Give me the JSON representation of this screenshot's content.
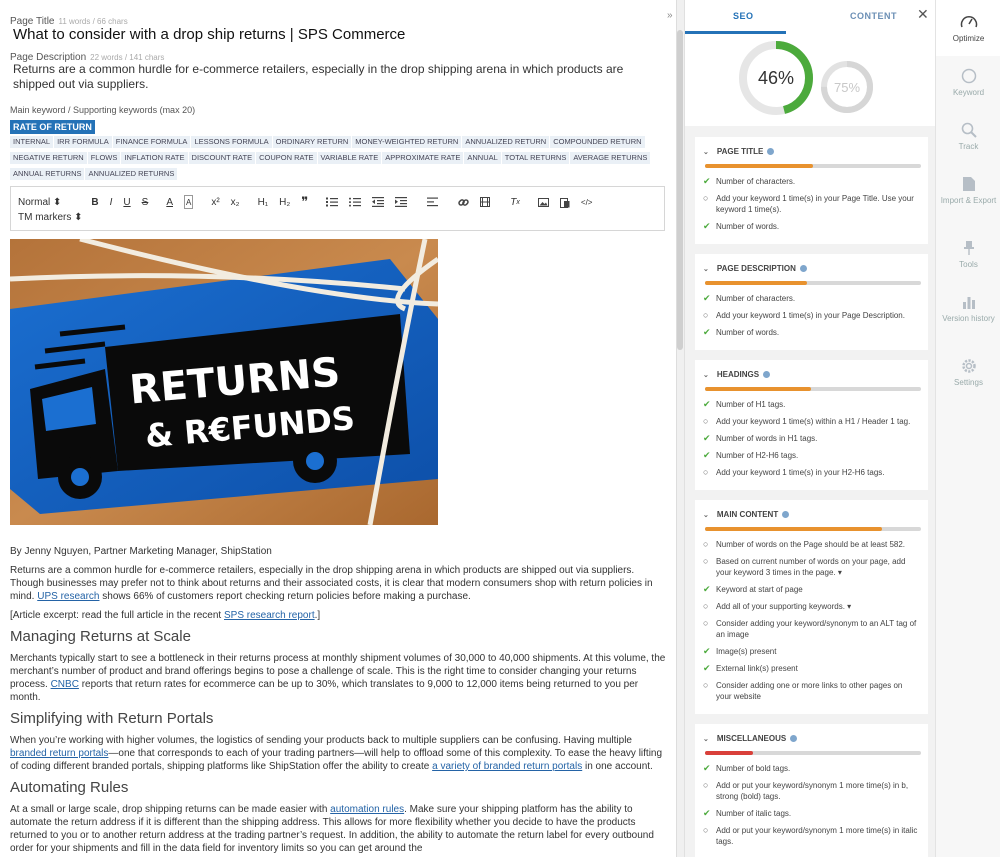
{
  "editor": {
    "page_title_label": "Page Title",
    "page_title_count": "11 words / 66 chars",
    "page_title": "What to consider with a drop ship returns | SPS Commerce",
    "page_desc_label": "Page Description",
    "page_desc_count": "22 words / 141 chars",
    "page_desc": "Returns are a common hurdle for e-commerce retailers, especially in the drop shipping arena in which products are shipped out via suppliers.",
    "kw_label": "Main keyword / Supporting keywords (max 20)",
    "main_keyword": "RATE OF RETURN",
    "tags": [
      "INTERNAL",
      "IRR FORMULA",
      "FINANCE FORMULA",
      "LESSONS FORMULA",
      "ORDINARY RETURN",
      "MONEY-WEIGHTED RETURN",
      "ANNUALIZED RETURN",
      "COMPOUNDED RETURN",
      "NEGATIVE RETURN",
      "FLOWS",
      "INFLATION RATE",
      "DISCOUNT RATE",
      "COUPON RATE",
      "VARIABLE RATE",
      "APPROXIMATE RATE",
      "ANNUAL",
      "TOTAL RETURNS",
      "AVERAGE RETURNS",
      "ANNUAL RETURNS",
      "ANNUALIZED RETURNS"
    ],
    "toolbar": {
      "format_select": "Normal ⬍",
      "bold": "B",
      "italic": "I",
      "underline": "U",
      "strike": "S",
      "color": "A",
      "bg": "A",
      "sup": "x²",
      "sub": "x₂",
      "h1": "H₁",
      "h2": "H₂",
      "quote": "❞",
      "tm_markers": "TM markers ⬍"
    },
    "hero_text_1": "RETURNS",
    "hero_text_2": "& R€FUNDS"
  },
  "article": {
    "author": "By Jenny Nguyen, Partner Marketing Manager, ShipStation",
    "p1_a": "Returns are a common hurdle for e-commerce retailers, especially in the drop shipping arena in which products are shipped out via suppliers. Though businesses may prefer not to think about returns and their associated costs, it is clear that modern consumers shop with return policies in mind. ",
    "p1_link": "UPS research",
    "p1_b": " shows 66% of customers report checking return policies before making a purchase.",
    "p2_a": "[Article excerpt: read the full article in the recent ",
    "p2_link": "SPS research report",
    "p2_b": ".]",
    "h_managing": "Managing Returns at Scale",
    "p3_a": "Merchants typically start to see a bottleneck in their returns process at monthly shipment volumes of 30,000 to 40,000 shipments. At this volume, the merchant’s number of product and brand offerings begins to pose a challenge of scale. This is the right time to consider changing your returns process. ",
    "p3_link": "CNBC",
    "p3_b": " reports that return rates for ecommerce can be up to 30%, which translates to 9,000 to 12,000 items being returned to you per month.",
    "h_simplifying": "Simplifying with Return Portals",
    "p4_a": "When you’re working with higher volumes, the logistics of sending your products back to multiple suppliers can be confusing. Having multiple ",
    "p4_link1": "branded return portals",
    "p4_b": "—one that corresponds to each of your trading partners—will help to offload some of this complexity. To ease the heavy lifting of coding different branded portals, shipping platforms like ShipStation offer the ability to create ",
    "p4_link2": "a variety of branded return portals",
    "p4_c": " in one account.",
    "h_automating": "Automating Rules",
    "p5_a": "At a small or large scale, drop shipping returns can be made easier with ",
    "p5_link": "automation rules",
    "p5_b": ". Make sure your shipping platform has the ability to automate the return address if it is different than the shipping address. This allows for more flexibility whether you decide to have the products returned to you or to another return address at the trading partner’s request. In addition, the ability to automate the return label for every outbound order for your shipments and fill in the data field for inventory limits so you can get around the"
  },
  "panel": {
    "tab_seo": "SEO",
    "tab_content": "CONTENT",
    "close": "✕",
    "score_main": "46%",
    "score_main_value": 46,
    "score_secondary": "75%",
    "score_secondary_value": 75,
    "colors": {
      "accent": "#2472b7",
      "green": "#4caa3c",
      "orange": "#e8922e",
      "red": "#d9403a"
    }
  },
  "sections": [
    {
      "title": "PAGE TITLE",
      "progress": 0.5,
      "color": "#e8922e",
      "items": [
        {
          "status": "ok",
          "text": "Number of characters."
        },
        {
          "status": "todo",
          "text": "Add your keyword 1 time(s) in your Page Title. Use your keyword 1 time(s)."
        },
        {
          "status": "ok",
          "text": "Number of words."
        }
      ]
    },
    {
      "title": "PAGE DESCRIPTION",
      "progress": 0.47,
      "color": "#e8922e",
      "items": [
        {
          "status": "ok",
          "text": "Number of characters."
        },
        {
          "status": "todo",
          "text": "Add your keyword 1 time(s) in your Page Description."
        },
        {
          "status": "ok",
          "text": "Number of words."
        }
      ]
    },
    {
      "title": "HEADINGS",
      "progress": 0.49,
      "color": "#e8922e",
      "items": [
        {
          "status": "ok",
          "text": "Number of H1 tags."
        },
        {
          "status": "todo",
          "text": "Add your keyword 1 time(s) within a H1 / Header 1 tag."
        },
        {
          "status": "ok",
          "text": "Number of words in H1 tags."
        },
        {
          "status": "ok",
          "text": "Number of H2-H6 tags."
        },
        {
          "status": "todo",
          "text": "Add your keyword 1 time(s) in your H2-H6 tags."
        }
      ]
    },
    {
      "title": "MAIN CONTENT",
      "progress": 0.82,
      "color": "#e8922e",
      "items": [
        {
          "status": "todo",
          "text": "Number of words on the Page should be at least 582."
        },
        {
          "status": "todo",
          "text": "Based on current number of words on your page, add your keyword 3 times in the page. ▾"
        },
        {
          "status": "ok",
          "text": "Keyword at start of page"
        },
        {
          "status": "todo",
          "text": "Add all of your supporting keywords. ▾"
        },
        {
          "status": "todo",
          "text": "Consider adding your keyword/synonym to an ALT tag of an image"
        },
        {
          "status": "ok",
          "text": "Image(s) present"
        },
        {
          "status": "ok",
          "text": "External link(s) present"
        },
        {
          "status": "todo",
          "text": "Consider adding one or more links to other pages on your website"
        }
      ]
    },
    {
      "title": "MISCELLANEOUS",
      "progress": 0.22,
      "color": "#d9403a",
      "items": [
        {
          "status": "ok",
          "text": "Number of bold tags."
        },
        {
          "status": "todo",
          "text": "Add or put your keyword/synonym 1 more time(s) in b, strong (bold) tags."
        },
        {
          "status": "ok",
          "text": "Number of italic tags."
        },
        {
          "status": "todo",
          "text": "Add or put your keyword/synonym 1 more time(s) in italic tags."
        }
      ]
    }
  ],
  "nav": {
    "optimize": "Optimize",
    "keyword": "Keyword",
    "track": "Track",
    "import_export": "Import & Export",
    "tools": "Tools",
    "version_history": "Version history",
    "settings": "Settings"
  }
}
